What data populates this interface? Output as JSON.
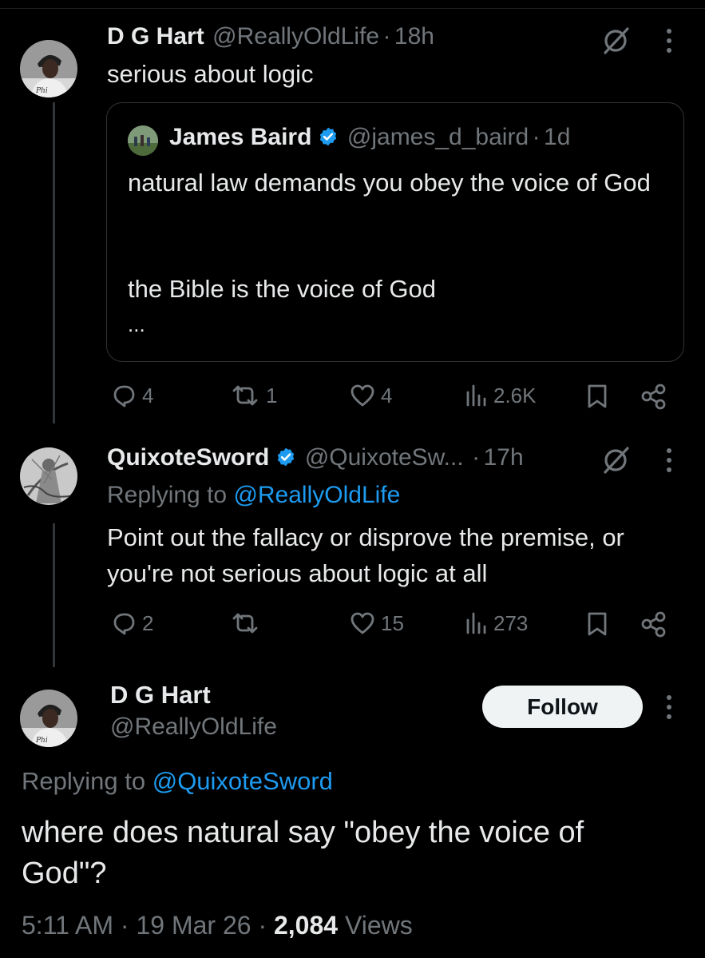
{
  "tweet1": {
    "name": "D G Hart",
    "handle": "@ReallyOldLife",
    "time": "18h",
    "text": "serious about logic",
    "quote": {
      "name": "James Baird",
      "handle": "@james_d_baird",
      "time": "1d",
      "line1": "natural law demands you obey the voice of God",
      "line2": "the Bible is the voice of God",
      "ellipsis": "..."
    },
    "stats": {
      "replies": "4",
      "reposts": "1",
      "likes": "4",
      "views": "2.6K"
    }
  },
  "tweet2": {
    "name": "QuixoteSword",
    "handle": "@QuixoteSw...",
    "time": "17h",
    "replying_prefix": "Replying to",
    "replying_to": "@ReallyOldLife",
    "text": "Point out the fallacy or disprove the premise, or you're not serious about logic at all",
    "stats": {
      "replies": "2",
      "reposts": "",
      "likes": "15",
      "views": "273"
    }
  },
  "main_tweet": {
    "name": "D G Hart",
    "handle": "@ReallyOldLife",
    "follow_label": "Follow",
    "replying_prefix": "Replying to",
    "replying_to": "@QuixoteSword",
    "text": "where does natural say \"obey the voice of God\"?",
    "time": "5:11 AM",
    "date": "19 Mar 26",
    "views_count": "2,084",
    "views_label": "Views"
  },
  "separator": "·",
  "icons": {
    "reply": "reply-icon",
    "repost": "repost-icon",
    "like": "heart-icon",
    "views": "views-icon",
    "bookmark": "bookmark-icon",
    "share": "share-icon",
    "more": "more-icon",
    "grok": "grok-icon",
    "verified": "verified-badge-icon"
  },
  "colors": {
    "background": "#000000",
    "text": "#e7e9ea",
    "muted": "#71767b",
    "link": "#1d9bf0",
    "verified": "#1d9bf0",
    "follow_bg": "#eff3f4"
  }
}
